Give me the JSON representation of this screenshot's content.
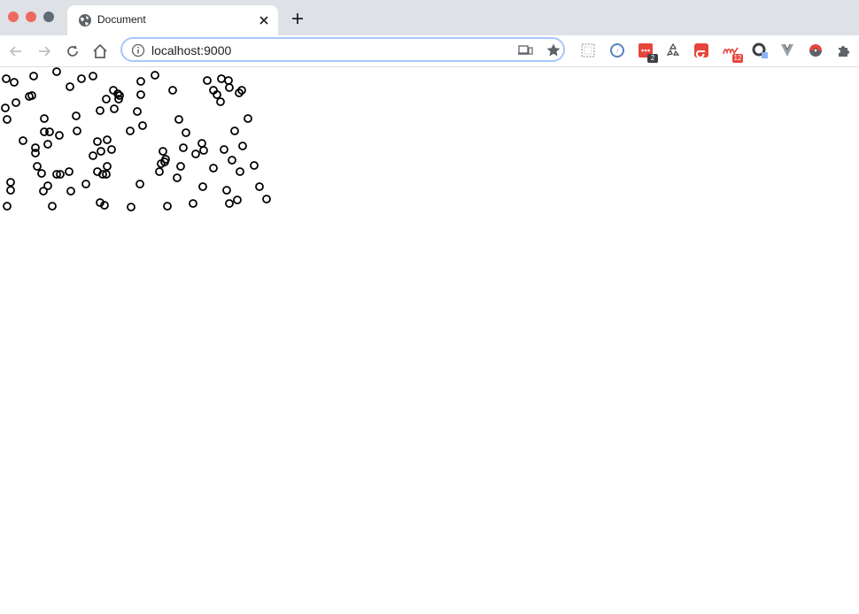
{
  "window": {
    "traffic_lights": [
      "close",
      "minimize",
      "maximize"
    ]
  },
  "tabs": [
    {
      "title": "Document",
      "icon": "globe-icon",
      "active": true
    }
  ],
  "toolbar": {
    "back_icon": "arrow-left-icon",
    "forward_icon": "arrow-right-icon",
    "reload_icon": "reload-icon",
    "home_icon": "home-icon",
    "url": "localhost:9000",
    "info_icon": "info-icon",
    "cast_icon": "cast-icon",
    "bookmark_icon": "star-icon"
  },
  "extensions": [
    {
      "name": "dotted-square-icon"
    },
    {
      "name": "compass-icon"
    },
    {
      "name": "red-menu-icon",
      "badge": "2",
      "badge_color": "#3c4043"
    },
    {
      "name": "recycle-icon"
    },
    {
      "name": "e-icon"
    },
    {
      "name": "m-icon",
      "badge": "12",
      "badge_color": "#e8453c"
    },
    {
      "name": "ring-icon",
      "badge": "",
      "badge_color": "#8ab4f8"
    },
    {
      "name": "v-icon"
    },
    {
      "name": "pokeball-icon"
    },
    {
      "name": "puzzle-icon"
    }
  ],
  "colors": {
    "tabstrip": "#dee1e6",
    "omnibox_border": "#a8c7fa",
    "circle_stroke": "#000000"
  },
  "page": {
    "circle_count": 114
  }
}
